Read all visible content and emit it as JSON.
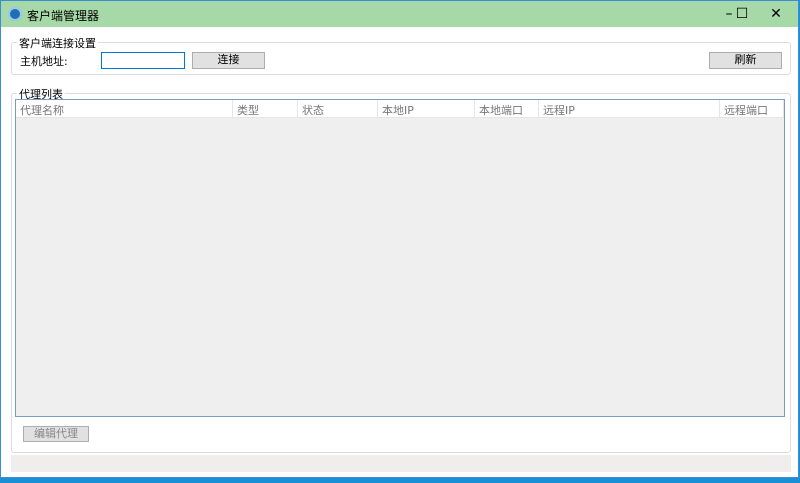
{
  "window": {
    "title": "客户端管理器",
    "minimize": "–",
    "maximize": "☐",
    "close": "✕"
  },
  "connection": {
    "group_title": "客户端连接设置",
    "host_label": "主机地址:",
    "host_value": "",
    "connect_label": "连接",
    "refresh_label": "刷新"
  },
  "proxies": {
    "group_title": "代理列表",
    "columns": [
      "代理名称",
      "类型",
      "状态",
      "本地IP",
      "本地端口",
      "远程IP",
      "远程端口"
    ],
    "edit_label": "编辑代理"
  }
}
